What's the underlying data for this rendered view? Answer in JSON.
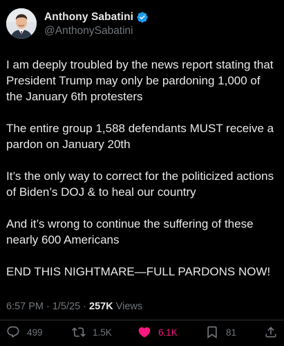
{
  "author": {
    "display_name": "Anthony Sabatini",
    "handle": "@AnthonySabatini",
    "verified": true,
    "verified_color": "#1d9bf0"
  },
  "tweet": {
    "paragraphs": [
      "I am deeply troubled by the news report stating that President Trump may only be pardoning 1,000 of the January 6th protesters",
      "The entire group 1,588 defendants MUST receive a pardon on January 20th",
      "It’s the only way to correct for the politicized actions of Biden’s DOJ & to heal our country",
      "And it’s wrong to continue the suffering of these nearly 600 Americans",
      "END THIS NIGHTMARE—FULL PARDONS NOW!"
    ]
  },
  "meta": {
    "time": "6:57 PM",
    "separator": "·",
    "date": "1/5/25",
    "views_count": "257K",
    "views_label": "Views"
  },
  "actions": {
    "replies": "499",
    "reposts": "1.5K",
    "likes": "6.1K",
    "bookmarks": "81",
    "liked": true
  },
  "icons": {
    "reply": "reply-icon",
    "repost": "repost-icon",
    "like": "heart-icon",
    "bookmark": "bookmark-icon",
    "share": "share-icon",
    "verified": "verified-badge-icon"
  },
  "colors": {
    "background": "#000000",
    "text": "#e7e9ea",
    "muted": "#71767b",
    "like": "#f91880",
    "verified": "#1d9bf0"
  }
}
